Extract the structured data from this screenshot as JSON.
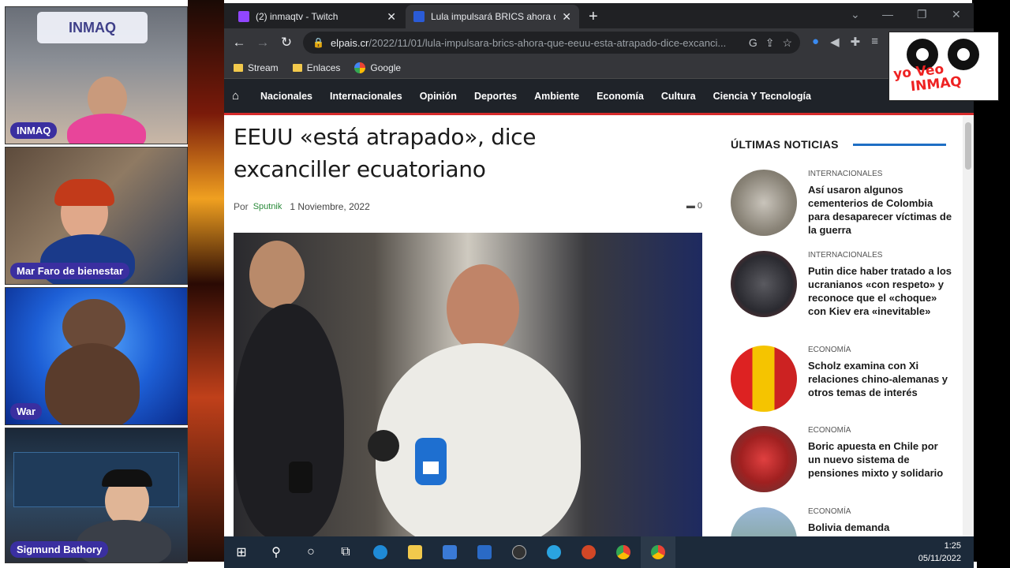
{
  "cams": [
    {
      "label": "INMAQ"
    },
    {
      "label": "Mar Faro de bienestar"
    },
    {
      "label": "War"
    },
    {
      "label": "Sigmund Bathory"
    }
  ],
  "cam1_banner": "INMAQ",
  "browser": {
    "tabs": [
      {
        "title": "(2) inmaqtv - Twitch",
        "fav_color": "#9146ff"
      },
      {
        "title": "Lula impulsará BRICS ahora que E",
        "fav_color": "#2a5bd7"
      }
    ],
    "url_host": "elpais.cr",
    "url_path": "/2022/11/01/lula-impulsara-brics-ahora-que-eeuu-esta-atrapado-dice-excanci...",
    "bookmarks": [
      "Stream",
      "Enlaces",
      "Google"
    ]
  },
  "site": {
    "nav": [
      "Nacionales",
      "Internacionales",
      "Opinión",
      "Deportes",
      "Ambiente",
      "Economía",
      "Cultura",
      "Ciencia Y Tecnología"
    ],
    "accent": "#d62b2b"
  },
  "article": {
    "headline_line1": "EEUU «está atrapado», dice",
    "headline_line2": "excanciller ecuatoriano",
    "by_prefix": "Por",
    "author": "Sputnik",
    "date": "1 Noviembre, 2022",
    "comments": "0"
  },
  "sidebar": {
    "title": "ÚLTIMAS NOTICIAS",
    "items": [
      {
        "category": "INTERNACIONALES",
        "title": "Así usaron algunos cementerios de Colombia para desaparecer víctimas de la guerra"
      },
      {
        "category": "INTERNACIONALES",
        "title": "Putin dice haber tratado a los ucranianos «con respeto» y reconoce que el «choque» con Kiev era «inevitable»"
      },
      {
        "category": "ECONOMÍA",
        "title": "Scholz examina con Xi relaciones chino-alemanas y otros temas de interés"
      },
      {
        "category": "ECONOMÍA",
        "title": "Boric apuesta en Chile por un nuevo sistema de pensiones mixto y solidario"
      },
      {
        "category": "ECONOMÍA",
        "title": "Bolivia demanda"
      }
    ]
  },
  "taskbar": {
    "time": "1:25",
    "date": "05/11/2022"
  },
  "logo": {
    "line1": "yo Veo",
    "line2": "INMAQ"
  }
}
